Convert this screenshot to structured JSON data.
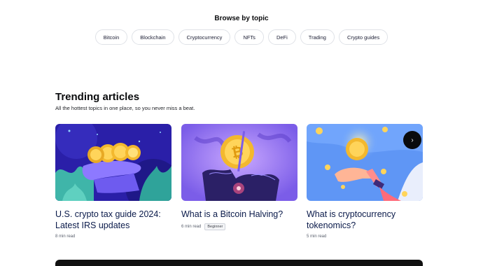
{
  "browse": {
    "title": "Browse by topic",
    "topics": [
      "Bitcoin",
      "Blockchain",
      "Cryptocurrency",
      "NFTs",
      "DeFi",
      "Trading",
      "Crypto guides"
    ]
  },
  "trending": {
    "title": "Trending articles",
    "subtitle": "All the hottest topics in one place, so you never miss a beat.",
    "next_icon": "chevron-right-icon",
    "articles": [
      {
        "title": "U.S. crypto tax guide 2024: Latest IRS updates",
        "read_time": "8 min read",
        "badge": null
      },
      {
        "title": "What is a Bitcoin Halving?",
        "read_time": "6 min read",
        "badge": "Beginner"
      },
      {
        "title": "What is cryptocurrency tokenomics?",
        "read_time": "5 min read",
        "badge": null
      }
    ]
  },
  "colors": {
    "chip_border": "#dfe2e7",
    "title_text": "#0a1a4a",
    "next_button": "#0a0b0d"
  }
}
